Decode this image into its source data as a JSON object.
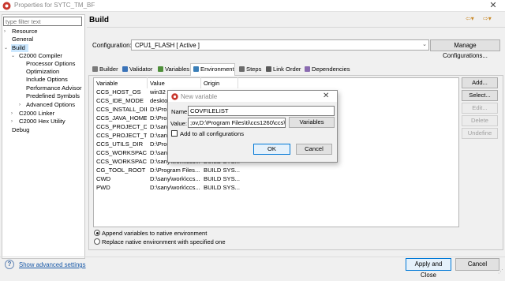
{
  "window": {
    "title": "Properties for SYTC_TM_BF",
    "close_glyph": "✕",
    "accent": "#c8372d"
  },
  "filter": {
    "placeholder": "type filter text"
  },
  "tree": {
    "items": [
      {
        "label": "Resource",
        "twisty": "›"
      },
      {
        "label": "General",
        "twisty": ""
      },
      {
        "label": "Build",
        "twisty": "⌄"
      },
      {
        "label": "C2000 Compiler",
        "twisty": "⌄"
      },
      {
        "label": "Processor Options",
        "twisty": ""
      },
      {
        "label": "Optimization",
        "twisty": ""
      },
      {
        "label": "Include Options",
        "twisty": ""
      },
      {
        "label": "Performance Advisor",
        "twisty": ""
      },
      {
        "label": "Predefined Symbols",
        "twisty": ""
      },
      {
        "label": "Advanced Options",
        "twisty": "›"
      },
      {
        "label": "C2000 Linker",
        "twisty": "›"
      },
      {
        "label": "C2000 Hex Utility",
        "twisty": "›"
      },
      {
        "label": "Debug",
        "twisty": ""
      }
    ]
  },
  "header": {
    "title": "Build",
    "nav_back": "⇦▾",
    "nav_fwd": "⇨▾"
  },
  "configuration": {
    "label": "Configuration:",
    "value": "CPU1_FLASH  [ Active ]",
    "arrow": "⌄",
    "manage_label": "Manage Configurations..."
  },
  "tabs": [
    {
      "label": "Builder",
      "icon": "builder-icon",
      "color": "#7a7a7a"
    },
    {
      "label": "Validator",
      "icon": "validator-icon",
      "color": "#3a73b8"
    },
    {
      "label": "Variables",
      "icon": "variables-icon",
      "color": "#4f8f3a"
    },
    {
      "label": "Environment",
      "icon": "environment-icon",
      "color": "#3a7fb8"
    },
    {
      "label": "Steps",
      "icon": "steps-icon",
      "color": "#6b6b6b"
    },
    {
      "label": "Link Order",
      "icon": "link-order-icon",
      "color": "#5a5a5a"
    },
    {
      "label": "Dependencies",
      "icon": "dependencies-icon",
      "color": "#8a6bb0"
    }
  ],
  "table": {
    "headers": [
      "Variable",
      "Value",
      "Origin"
    ],
    "rows": [
      [
        "CCS_HOST_OS",
        "win32",
        ""
      ],
      [
        "CCS_IDE_MODE",
        "deskto",
        ""
      ],
      [
        "CCS_INSTALL_DIR",
        "D:\\Pro",
        ""
      ],
      [
        "CCS_JAVA_HOME",
        "D:\\Pro",
        ""
      ],
      [
        "CCS_PROJECT_DIR",
        "D:\\san",
        ""
      ],
      [
        "CCS_PROJECT_TE...",
        "D:\\san",
        ""
      ],
      [
        "CCS_UTILS_DIR",
        "D:\\Prog",
        ""
      ],
      [
        "CCS_WORKSPAC...",
        "D:\\san",
        ""
      ],
      [
        "CCS_WORKSPAC...",
        "D:\\sany\\work\\ccs...",
        "BUILD SYS..."
      ],
      [
        "CG_TOOL_ROOT",
        "D:\\Program Files...",
        "BUILD SYS..."
      ],
      [
        "CWD",
        "D:\\sany\\work\\ccs...",
        "BUILD SYS..."
      ],
      [
        "PWD",
        "D:\\sany\\work\\ccs...",
        "BUILD SYS..."
      ]
    ]
  },
  "side_buttons": [
    {
      "label": "Add...",
      "disabled": false
    },
    {
      "label": "Select...",
      "disabled": false
    },
    {
      "label": "Edit...",
      "disabled": true
    },
    {
      "label": "Delete",
      "disabled": true
    },
    {
      "label": "Undefine",
      "disabled": true
    }
  ],
  "radios": {
    "append_label": "Append variables to native environment",
    "replace_label": "Replace native environment with specified one",
    "selected": "append"
  },
  "footer": {
    "help_glyph": "?",
    "advanced_link": "Show advanced settings",
    "apply_close": "Apply and Close",
    "cancel": "Cancel"
  },
  "dialog": {
    "title": "New variable",
    "close_glyph": "✕",
    "name_label": "Name:",
    "name_value": "COVFILELIST",
    "value_label": "Value:",
    "value_value": ";ov,D:\\Program Files\\ti\\ccs1260\\ccs\\",
    "variables_btn": "Variables",
    "add_all_label": "Add to all configurations",
    "add_all_checked": false,
    "ok": "OK",
    "cancel": "Cancel"
  }
}
